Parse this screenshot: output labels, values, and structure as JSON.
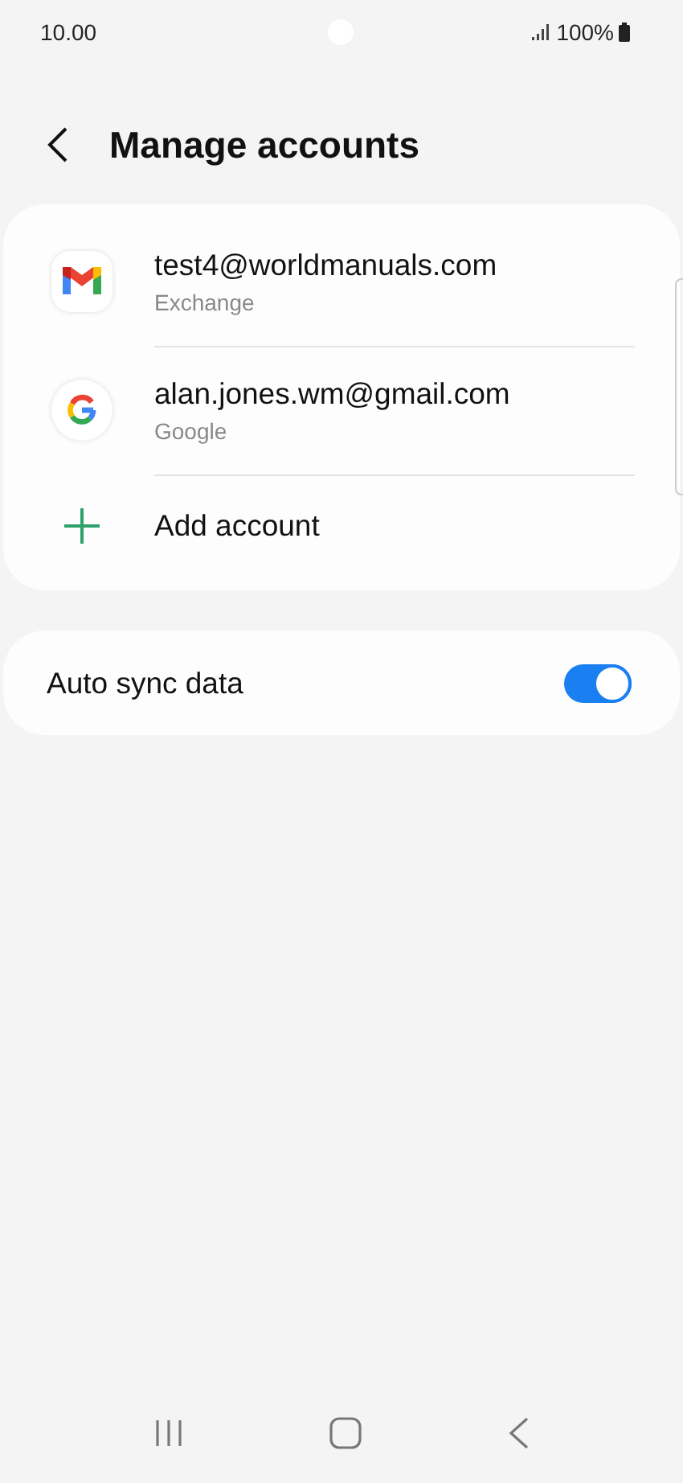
{
  "status_bar": {
    "time": "10.00",
    "battery": "100%"
  },
  "header": {
    "title": "Manage accounts"
  },
  "accounts": [
    {
      "kind": "gmail",
      "address": "test4@worldmanuals.com",
      "type": "Exchange"
    },
    {
      "kind": "google",
      "address": "alan.jones.wm@gmail.com",
      "type": "Google"
    },
    {
      "kind": "add",
      "address": "Add account"
    }
  ],
  "settings": [
    {
      "label": "Auto sync data",
      "on": true
    }
  ]
}
